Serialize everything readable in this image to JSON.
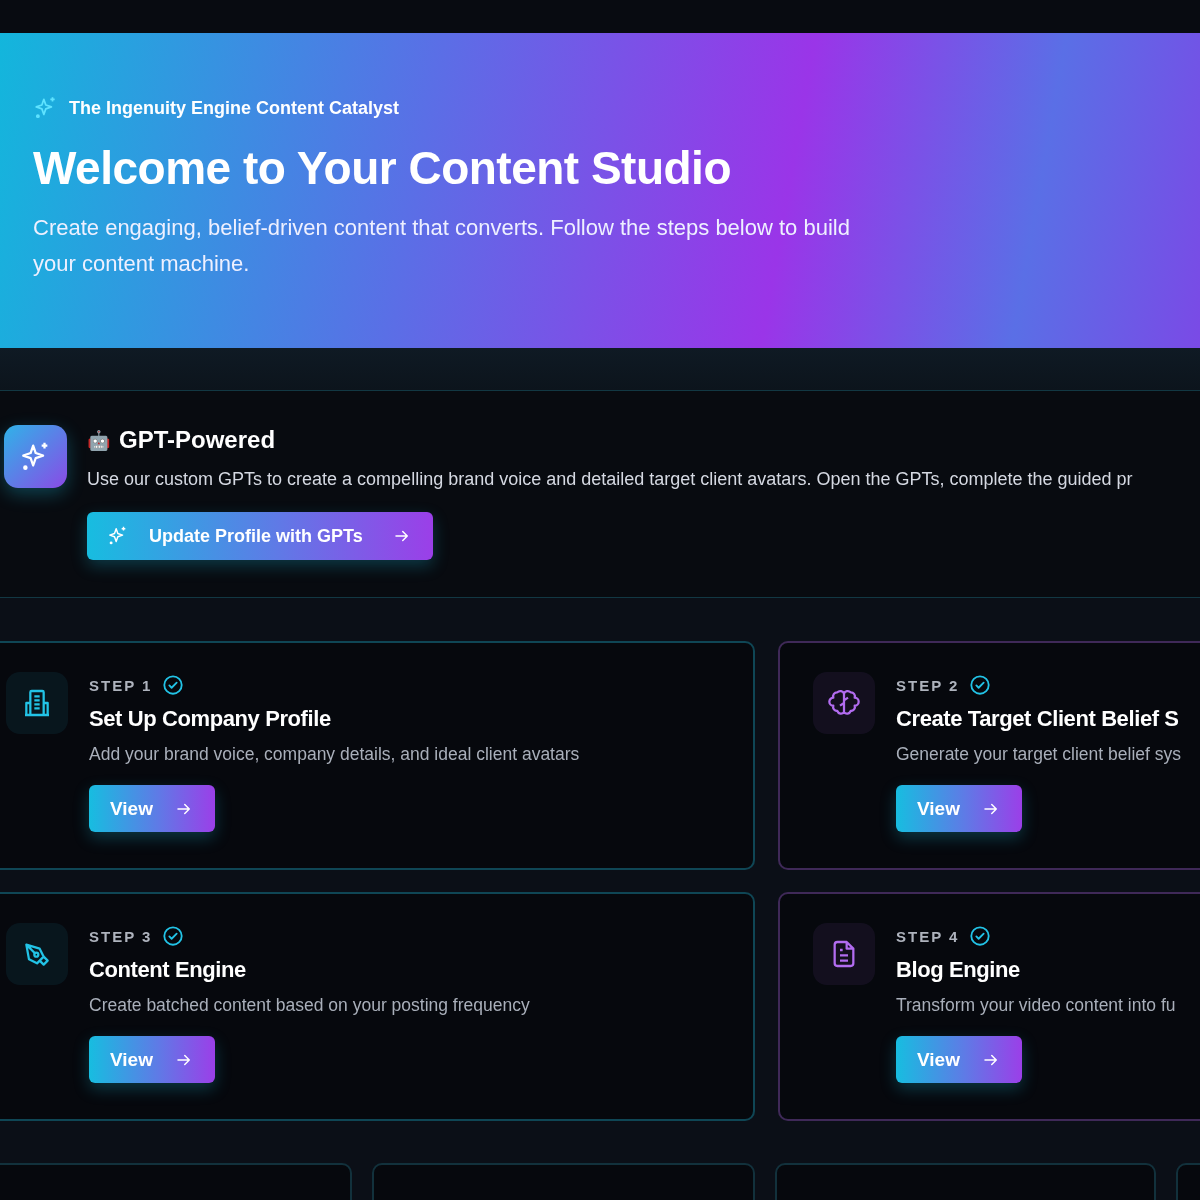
{
  "hero": {
    "eyebrow": "The Ingenuity Engine Content Catalyst",
    "title": "Welcome to Your Content Studio",
    "subtitle": "Create engaging, belief-driven content that converts. Follow the steps below to build your content machine."
  },
  "gpt_panel": {
    "emoji": "🤖",
    "title": "GPT-Powered",
    "description": "Use our custom GPTs to create a compelling brand voice and detailed target client avatars. Open the GPTs, complete the guided pr",
    "button": "Update Profile with GPTs"
  },
  "steps": [
    {
      "step": "STEP 1",
      "completed": true,
      "title": "Set Up Company Profile",
      "description": "Add your brand voice, company details, and ideal client avatars",
      "button": "View",
      "color": "#22c3e6"
    },
    {
      "step": "STEP 2",
      "completed": true,
      "title": "Create Target Client Belief S",
      "description": "Generate your target client belief sys",
      "button": "View",
      "color": "#b26cf0"
    },
    {
      "step": "STEP 3",
      "completed": true,
      "title": "Content Engine",
      "description": "Create batched content based on your posting frequency",
      "button": "View",
      "color": "#22c3e6"
    },
    {
      "step": "STEP 4",
      "completed": true,
      "title": "Blog Engine",
      "description": "Transform your video content into fu",
      "button": "View",
      "color": "#b26cf0"
    }
  ]
}
